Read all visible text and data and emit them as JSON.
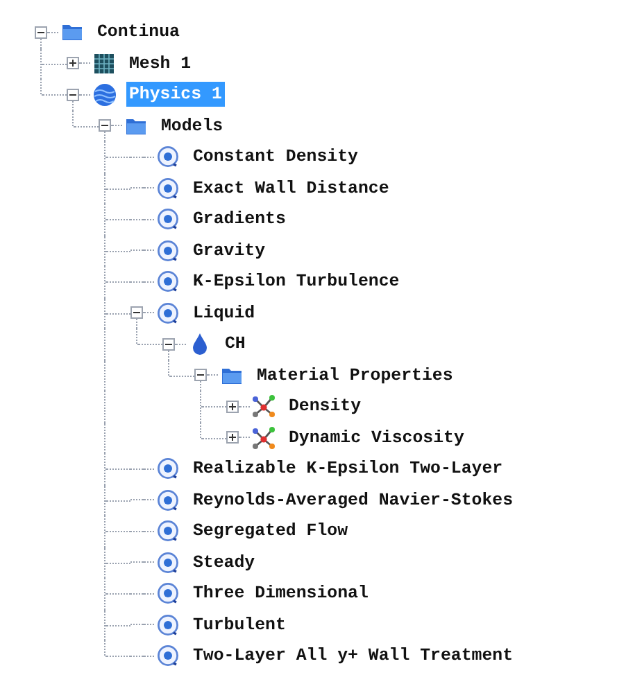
{
  "nodes": [
    {
      "label": "Continua",
      "kind": "folder",
      "expanded": true,
      "selected": false,
      "children": [
        {
          "label": "Mesh 1",
          "kind": "mesh",
          "expanded": false,
          "selected": false
        },
        {
          "label": "Physics 1",
          "kind": "physics",
          "expanded": true,
          "selected": true,
          "children": [
            {
              "label": "Models",
              "kind": "folder",
              "expanded": true,
              "selected": false,
              "children": [
                {
                  "label": "Constant Density",
                  "kind": "model",
                  "selected": false
                },
                {
                  "label": "Exact Wall Distance",
                  "kind": "model",
                  "selected": false
                },
                {
                  "label": "Gradients",
                  "kind": "model",
                  "selected": false
                },
                {
                  "label": "Gravity",
                  "kind": "model",
                  "selected": false
                },
                {
                  "label": "K-Epsilon Turbulence",
                  "kind": "model",
                  "selected": false
                },
                {
                  "label": "Liquid",
                  "kind": "model",
                  "expanded": true,
                  "selected": false,
                  "children": [
                    {
                      "label": "CH",
                      "kind": "material",
                      "expanded": true,
                      "selected": false,
                      "children": [
                        {
                          "label": "Material Properties",
                          "kind": "folder",
                          "expanded": true,
                          "selected": false,
                          "children": [
                            {
                              "label": "Density",
                              "kind": "property",
                              "expanded": false,
                              "selected": false
                            },
                            {
                              "label": "Dynamic Viscosity",
                              "kind": "property",
                              "expanded": false,
                              "selected": false
                            }
                          ]
                        }
                      ]
                    }
                  ]
                },
                {
                  "label": "Realizable K-Epsilon Two-Layer",
                  "kind": "model",
                  "selected": false
                },
                {
                  "label": "Reynolds-Averaged Navier-Stokes",
                  "kind": "model",
                  "selected": false
                },
                {
                  "label": "Segregated Flow",
                  "kind": "model",
                  "selected": false
                },
                {
                  "label": "Steady",
                  "kind": "model",
                  "selected": false
                },
                {
                  "label": "Three Dimensional",
                  "kind": "model",
                  "selected": false
                },
                {
                  "label": "Turbulent",
                  "kind": "model",
                  "selected": false
                },
                {
                  "label": "Two-Layer All y+ Wall Treatment",
                  "kind": "model",
                  "selected": false
                }
              ]
            }
          ]
        }
      ]
    }
  ]
}
